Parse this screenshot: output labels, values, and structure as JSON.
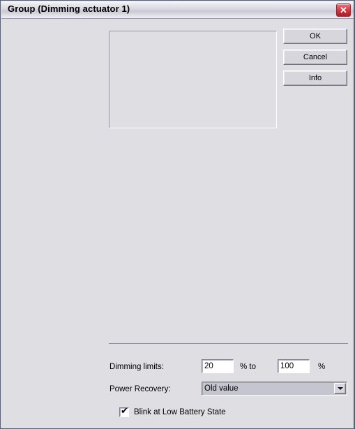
{
  "window": {
    "title": "Group (Dimming actuator 1)",
    "close_icon": "close-icon",
    "close_glyph": "✕",
    "frame_color": "#5b5f73",
    "client_background": "#dedee3"
  },
  "buttons": {
    "ok_label": "OK",
    "cancel_label": "Cancel",
    "info_label": "Info"
  },
  "preview_panel": {
    "content": ""
  },
  "form": {
    "dimming_limits_label": "Dimming limits:",
    "dimming_min_value": "20",
    "dimming_max_value": "100",
    "percent_to_label": "% to",
    "percent_label": "%",
    "power_recovery_label": "Power Recovery:",
    "power_recovery_value": "Old value",
    "power_recovery_options": [
      "Old value"
    ],
    "combo_arrow_icon": "chevron-down-icon",
    "blink_checkbox_label": "Blink at Low Battery State",
    "blink_checkbox_checked": true,
    "check_glyph": "✔"
  }
}
